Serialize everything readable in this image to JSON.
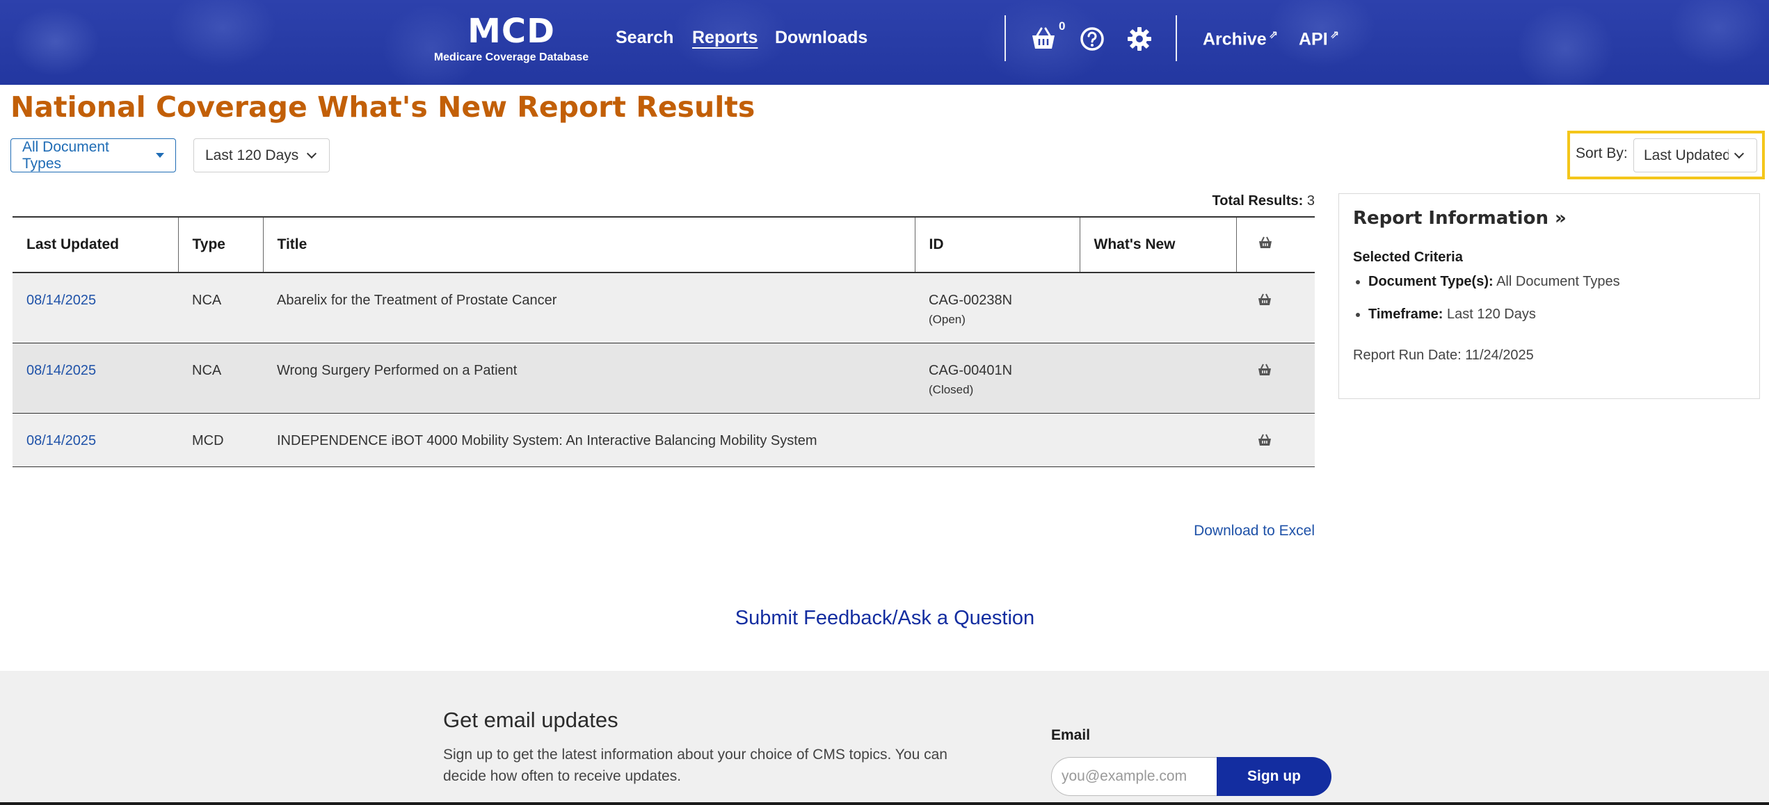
{
  "header": {
    "logo": "MCD",
    "logo_subtitle": "Medicare Coverage Database",
    "nav": {
      "search": "Search",
      "reports": "Reports",
      "downloads": "Downloads",
      "archive": "Archive",
      "api": "API"
    },
    "cart_count": "0"
  },
  "page_title": "National Coverage What's New Report Results",
  "filters": {
    "document_types": "All Document Types",
    "timeframe": "Last 120 Days",
    "sort_label": "Sort By:",
    "sort_value": "Last Updated"
  },
  "results": {
    "total_label": "Total Results:",
    "total_value": "3",
    "columns": {
      "last_updated": "Last Updated",
      "type": "Type",
      "title": "Title",
      "id": "ID",
      "whats_new": "What's New"
    },
    "rows": [
      {
        "date": "08/14/2025",
        "type": "NCA",
        "title": "Abarelix for the Treatment of Prostate Cancer",
        "id": "CAG-00238N",
        "status": "(Open)"
      },
      {
        "date": "08/14/2025",
        "type": "NCA",
        "title": "Wrong Surgery Performed on a Patient",
        "id": "CAG-00401N",
        "status": "(Closed)"
      },
      {
        "date": "08/14/2025",
        "type": "MCD",
        "title": "INDEPENDENCE iBOT 4000 Mobility System: An Interactive Balancing Mobility System",
        "id": "",
        "status": ""
      }
    ]
  },
  "report_info": {
    "heading": "Report Information »",
    "criteria_heading": "Selected Criteria",
    "doc_types_label": "Document Type(s):",
    "doc_types_value": "All Document Types",
    "timeframe_label": "Timeframe:",
    "timeframe_value": "Last 120 Days",
    "run_date": "Report Run Date: 11/24/2025"
  },
  "download_link": "Download to Excel",
  "feedback_link": "Submit Feedback/Ask a Question",
  "footer": {
    "title": "Get email updates",
    "description": "Sign up to get the latest information about your choice of CMS topics. You can decide how often to receive updates.",
    "email_label": "Email",
    "email_placeholder": "you@example.com",
    "signup_label": "Sign up"
  },
  "colors": {
    "header_blue": "#2a3fa8",
    "title_orange": "#c25f07",
    "link_blue": "#1f52a8",
    "highlight_yellow": "#f4c61b",
    "signup_navy": "#132da0"
  }
}
